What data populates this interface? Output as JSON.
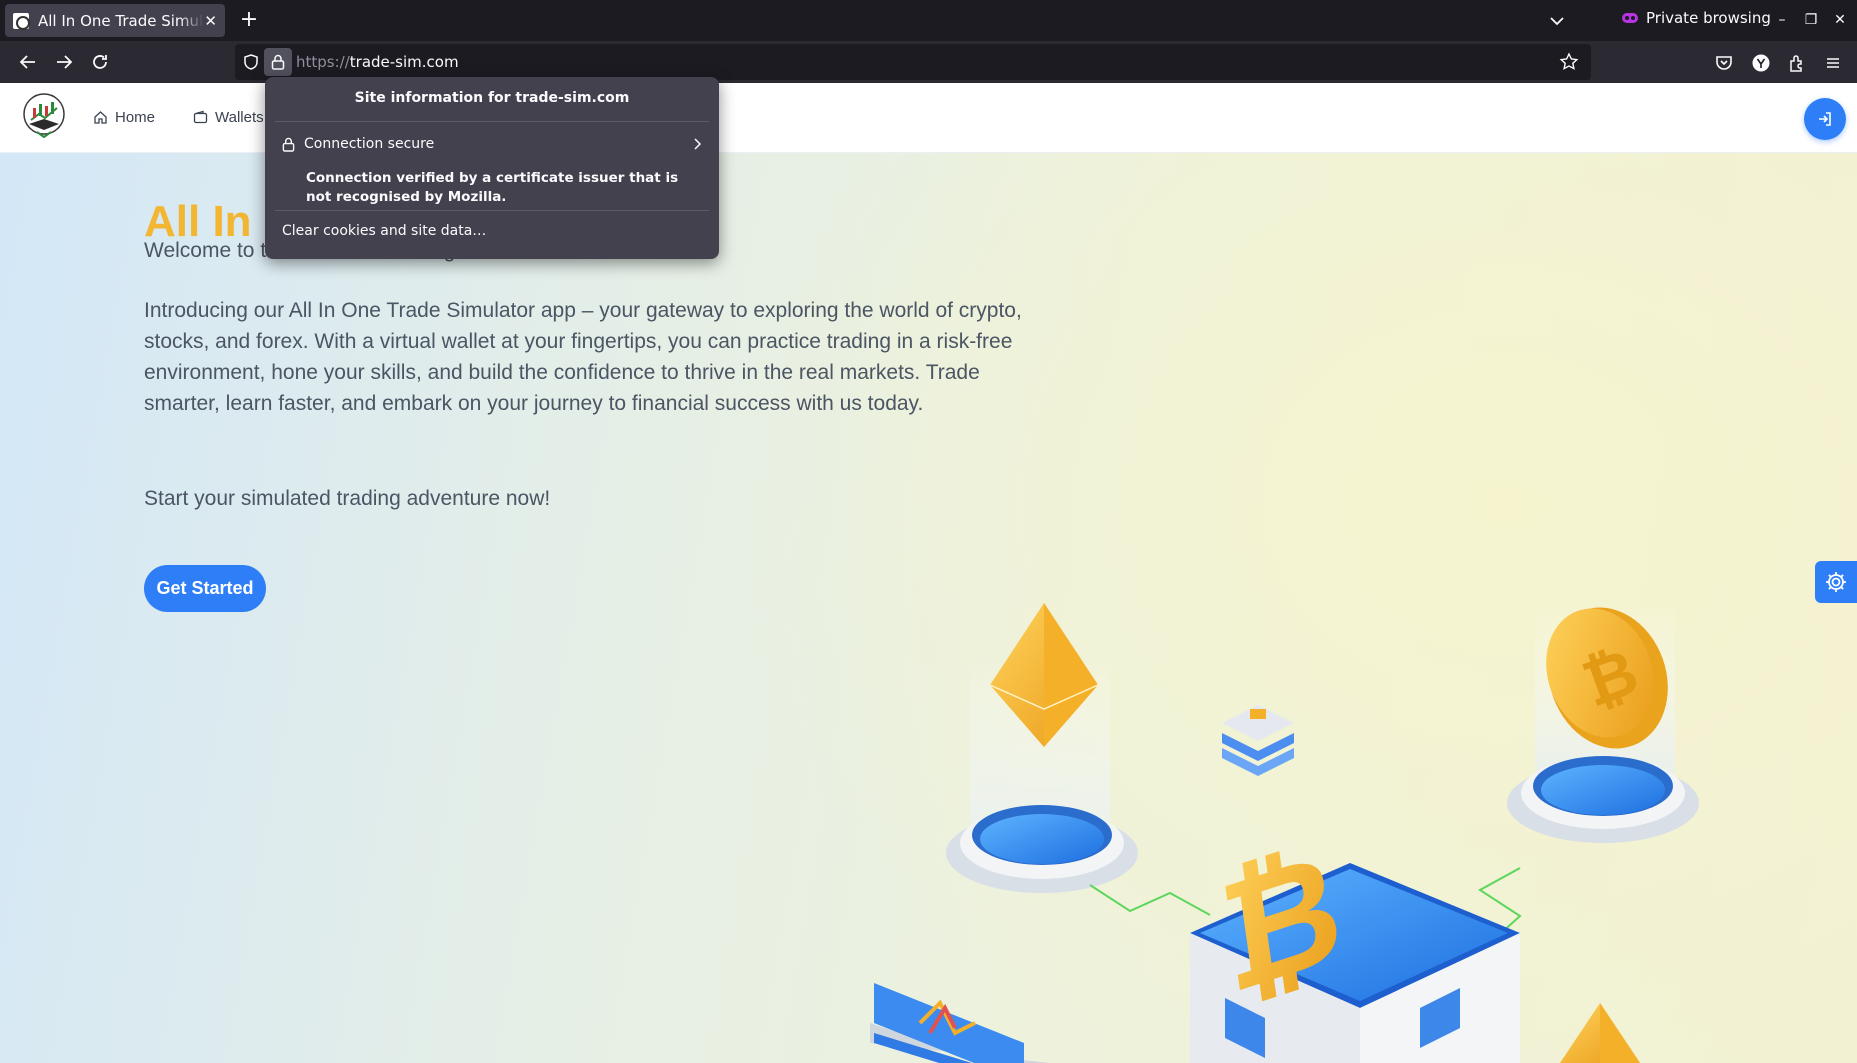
{
  "browser": {
    "tab_title": "All In One Trade Simulator",
    "private_label": "Private browsing",
    "url_scheme": "https://",
    "url_host": "trade-sim.com"
  },
  "site_info_popup": {
    "title": "Site information for trade-sim.com",
    "connection_label": "Connection secure",
    "detail": "Connection verified by a certificate issuer that is not recognised by Mozilla.",
    "clear_label": "Clear cookies and site data…"
  },
  "site": {
    "nav": [
      {
        "label": "Home",
        "icon": "home-icon"
      },
      {
        "label": "Wallets",
        "icon": "wallet-icon"
      }
    ],
    "hero": {
      "title": "All In One Trade Simulator",
      "welcome": "Welcome to the Future of Trading!",
      "intro": "Introducing our All In One Trade Simulator app – your gateway to exploring the world of crypto, stocks, and forex. With a virtual wallet at your fingertips, you can practice trading in a risk-free environment, hone your skills, and build the confidence to thrive in the real markets. Trade smarter, learn faster, and embark on your journey to financial success with us today.",
      "cta_prompt": "Start your simulated trading adventure now!",
      "cta_label": "Get Started"
    }
  },
  "colors": {
    "accent_blue": "#2d7ef7",
    "title_gold": "#f2b632",
    "chrome_dark": "#1c1b22"
  }
}
